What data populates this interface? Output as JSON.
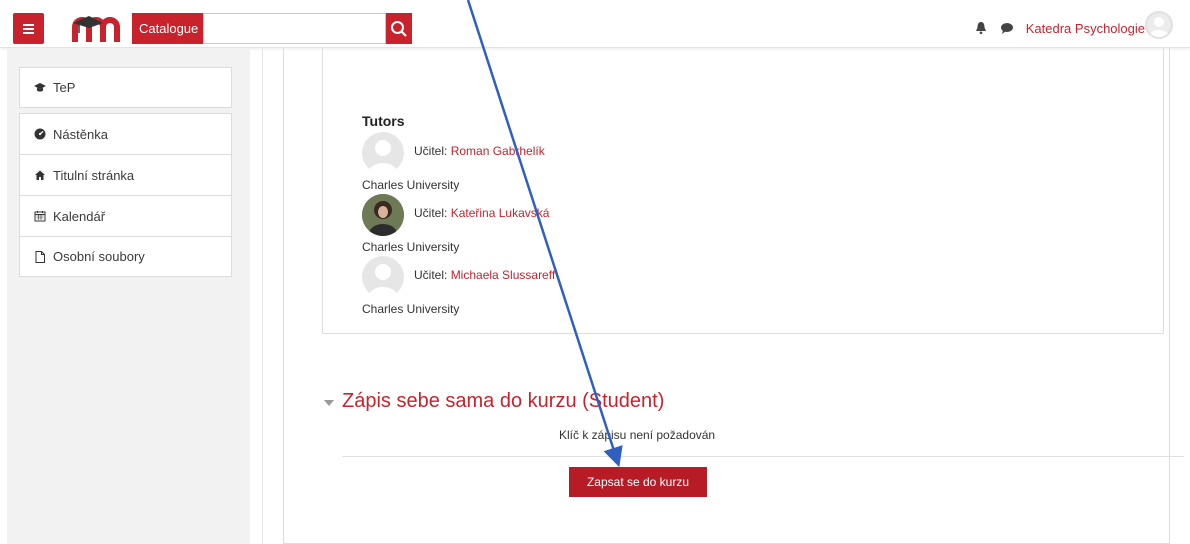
{
  "header": {
    "search_label": "Catalogue",
    "search_placeholder": "",
    "user_name": "Katedra Psychologie"
  },
  "sidebar": {
    "items": [
      {
        "label": "TeP",
        "icon": "graduation-cap-icon"
      },
      {
        "label": "Nástěnka",
        "icon": "dashboard-icon"
      },
      {
        "label": "Titulní stránka",
        "icon": "home-icon"
      },
      {
        "label": "Kalendář",
        "icon": "calendar-icon"
      },
      {
        "label": "Osobní soubory",
        "icon": "file-icon"
      }
    ]
  },
  "main": {
    "tutors_heading": "Tutors",
    "tutors": [
      {
        "role": "Učitel: ",
        "name": "Roman Gabrhelík",
        "org": "Charles University"
      },
      {
        "role": "Učitel: ",
        "name": "Kateřina Lukavská",
        "org": "Charles University"
      },
      {
        "role": "Učitel: ",
        "name": "Michaela Slussareff",
        "org": "Charles University"
      }
    ],
    "enrol_section_title": "Zápis sebe sama do kurzu (Student)",
    "no_key_text": "Klíč k zápisu není požadován",
    "enrol_button": "Zapsat se do kurzu"
  },
  "colors": {
    "accent": "#c8222c",
    "arrow": "#2f5fbf"
  }
}
